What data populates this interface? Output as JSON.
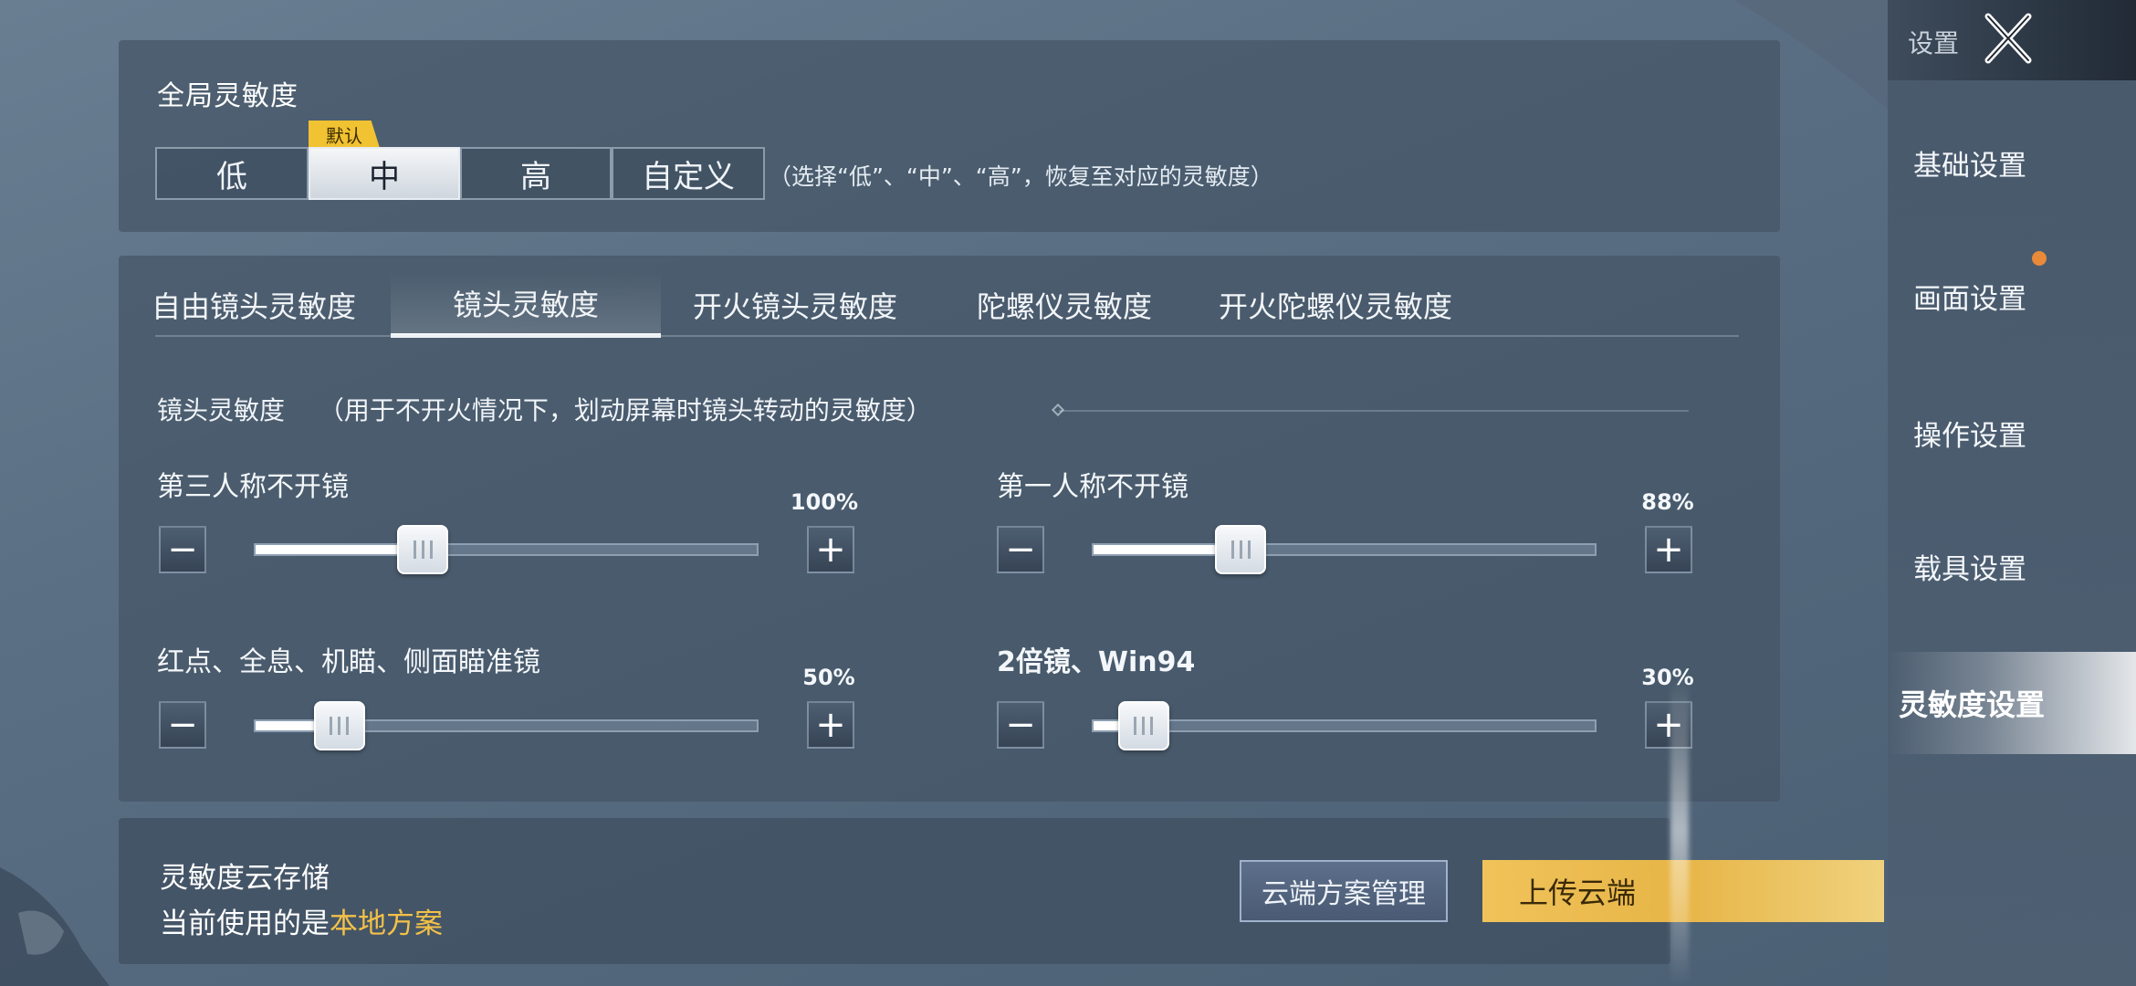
{
  "sidebar": {
    "title": "设置",
    "items": [
      {
        "label": "基础设置"
      },
      {
        "label": "画面设置"
      },
      {
        "label": "操作设置"
      },
      {
        "label": "载具设置"
      },
      {
        "label": "灵敏度设置"
      }
    ],
    "active_index": 4
  },
  "global": {
    "title": "全局灵敏度",
    "default_tag": "默认",
    "options": [
      "低",
      "中",
      "高",
      "自定义"
    ],
    "selected": "中",
    "hint": "（选择“低”、“中”、“高”，恢复至对应的灵敏度）"
  },
  "tabs": {
    "items": [
      "自由镜头灵敏度",
      "镜头灵敏度",
      "开火镜头灵敏度",
      "陀螺仪灵敏度",
      "开火陀螺仪灵敏度"
    ],
    "active": "镜头灵敏度"
  },
  "camera": {
    "title": "镜头灵敏度",
    "description": "（用于不开火情况下，划动屏幕时镜头转动的灵敏度）",
    "sliders": [
      {
        "label": "第三人称不开镜",
        "value_text": "100%",
        "value": 100,
        "max": 300
      },
      {
        "label": "第一人称不开镜",
        "value_text": "88%",
        "value": 88,
        "max": 300
      },
      {
        "label": "红点、全息、机瞄、侧面瞄准镜",
        "value_text": "50%",
        "value": 50,
        "max": 300
      },
      {
        "label": "2倍镜、Win94",
        "value_text": "30%",
        "value": 30,
        "max": 300
      }
    ],
    "minus_symbol": "−",
    "plus_symbol": "+"
  },
  "cloud": {
    "title": "灵敏度云存储",
    "current_prefix": "当前使用的是",
    "current_plan": "本地方案",
    "manage_button": "云端方案管理",
    "upload_button": "上传云端"
  },
  "colors": {
    "accent_yellow": "#f1c232",
    "highlight_orange": "#f3c148",
    "badge_orange": "#e88a3a"
  }
}
